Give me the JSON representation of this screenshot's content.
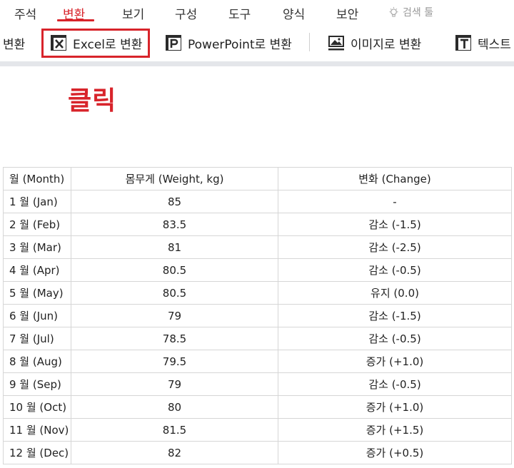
{
  "menu": {
    "tabs": [
      {
        "label": "주석"
      },
      {
        "label": "변환",
        "active": true
      },
      {
        "label": "보기"
      },
      {
        "label": "구성"
      },
      {
        "label": "도구"
      },
      {
        "label": "양식"
      },
      {
        "label": "보안"
      }
    ],
    "search_tool_label": "검색 툴"
  },
  "ribbon": {
    "group_label": "변환",
    "excel_label": "Excel로 변환",
    "powerpoint_label": "PowerPoint로 변환",
    "image_label": "이미지로 변환",
    "text_label": "텍스트"
  },
  "callout": "클릭",
  "colors": {
    "accent": "#d8242b"
  },
  "table": {
    "headers": [
      "월 (Month)",
      "몸무게 (Weight, kg)",
      "변화 (Change)"
    ],
    "rows": [
      [
        "1 월 (Jan)",
        "85",
        "-"
      ],
      [
        "2 월 (Feb)",
        "83.5",
        "감소 (-1.5)"
      ],
      [
        "3 월 (Mar)",
        "81",
        "감소 (-2.5)"
      ],
      [
        "4 월 (Apr)",
        "80.5",
        "감소 (-0.5)"
      ],
      [
        "5 월 (May)",
        "80.5",
        "유지 (0.0)"
      ],
      [
        "6 월 (Jun)",
        "79",
        "감소 (-1.5)"
      ],
      [
        "7 월 (Jul)",
        "78.5",
        "감소 (-0.5)"
      ],
      [
        "8 월 (Aug)",
        "79.5",
        "증가 (+1.0)"
      ],
      [
        "9 월 (Sep)",
        "79",
        "감소 (-0.5)"
      ],
      [
        "10 월 (Oct)",
        "80",
        "증가 (+1.0)"
      ],
      [
        "11 월 (Nov)",
        "81.5",
        "증가 (+1.5)"
      ],
      [
        "12 월 (Dec)",
        "82",
        "증가 (+0.5)"
      ]
    ]
  }
}
